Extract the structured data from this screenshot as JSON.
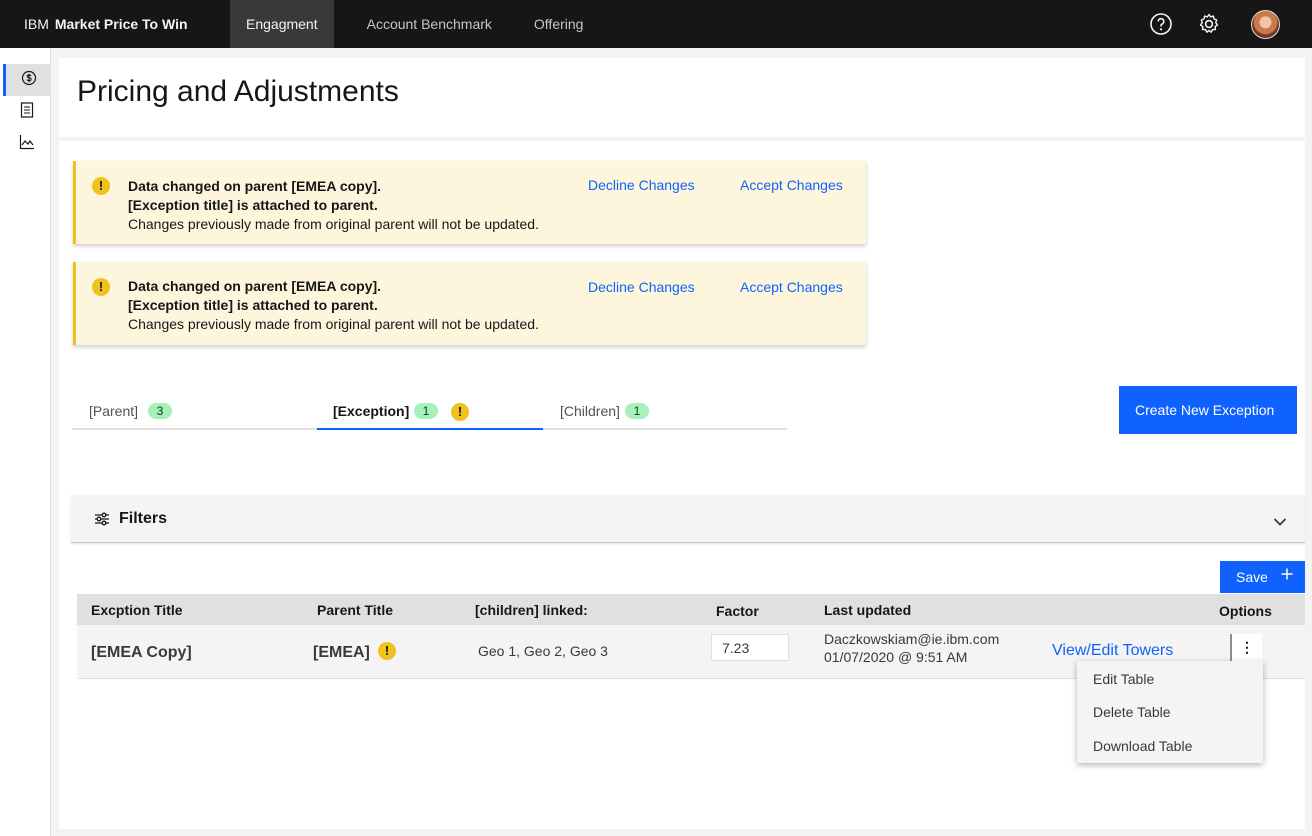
{
  "header": {
    "brand_prefix": "IBM",
    "brand_name": "Market Price To Win",
    "nav": [
      "Engagment",
      "Account Benchmark",
      "Offering"
    ],
    "active_nav": "Engagment"
  },
  "page": {
    "title": "Pricing and Adjustments"
  },
  "notifications": [
    {
      "line1": "Data changed on parent [EMEA copy].",
      "line2": "[Exception title] is attached to parent.",
      "line3": "Changes previously made from original parent will not be updated.",
      "decline": "Decline Changes",
      "accept": "Accept Changes"
    },
    {
      "line1": "Data changed on parent [EMEA copy].",
      "line2": "[Exception title] is attached to parent.",
      "line3": "Changes previously made from original parent will not be updated.",
      "decline": "Decline Changes",
      "accept": "Accept Changes"
    }
  ],
  "tabs": [
    {
      "label": "[Parent]",
      "count": "3"
    },
    {
      "label": "[Exception]",
      "count": "1"
    },
    {
      "label": "[Children]",
      "count": "1"
    }
  ],
  "create_button": "Create New Exception",
  "filters": {
    "title": "Filters"
  },
  "save_button": "Save",
  "table": {
    "headers": [
      "Excption Title",
      "Parent Title",
      "[children] linked:",
      "Factor",
      "Last updated",
      "Options"
    ],
    "row": {
      "title": "[EMEA Copy]",
      "parent": "[EMEA]",
      "linked": "Geo 1, Geo 2, Geo 3",
      "factor": "7.23",
      "updated_by": "Daczkowskiam@ie.ibm.com",
      "updated_at": "01/07/2020 @ 9:51 AM",
      "view_link": "View/Edit Towers"
    }
  },
  "menu": [
    "Edit Table",
    "Delete Table",
    "Download Table"
  ],
  "colors": {
    "accent": "#0f62fe",
    "warning": "#f1c21b",
    "tag": "#a7f0ba"
  }
}
